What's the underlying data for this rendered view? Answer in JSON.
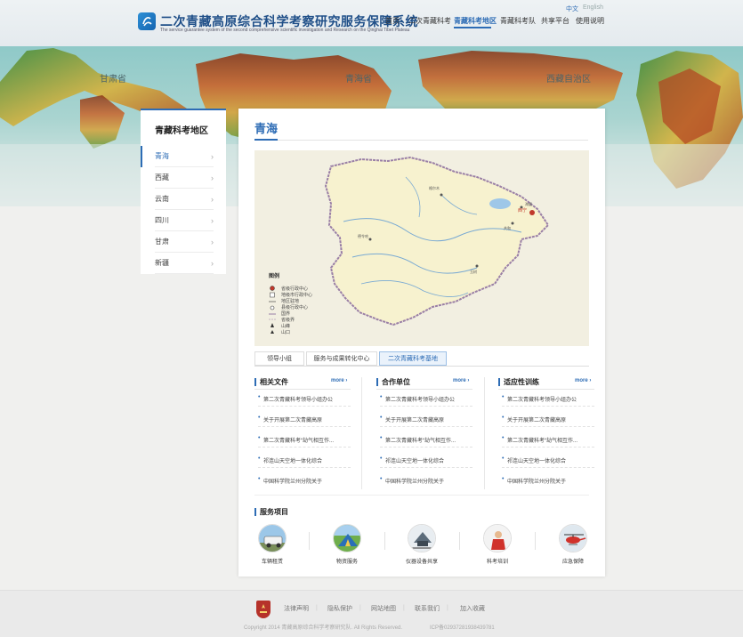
{
  "header": {
    "title": "二次青藏高原综合科学考察研究服务保障系统",
    "subtitle": "The service guarantee system of the second comprehensive scientific investigation and Research on the Qinghai Tibet Plateau",
    "lang_zh": "中文",
    "lang_en": "English",
    "nav": [
      "首页",
      "二次青藏科考",
      "青藏科考地区",
      "青藏科考队",
      "共享平台",
      "使用说明"
    ],
    "active_nav": "青藏科考地区"
  },
  "banner": {
    "labels": [
      "甘肃省",
      "青海省",
      "西藏自治区"
    ]
  },
  "sidebar": {
    "title": "青藏科考地区",
    "items": [
      "青海",
      "西藏",
      "云南",
      "四川",
      "甘肃",
      "新疆"
    ],
    "active": "青海"
  },
  "main": {
    "title": "青海",
    "map": {
      "legend_title": "图例",
      "legend_items": [
        "省级行政中心",
        "地级市行政中心",
        "地区驻地",
        "县级行政中心",
        "国界",
        "省级界",
        "山峰",
        "山口"
      ],
      "capital_label": "西宁",
      "place_labels": [
        "格尔木",
        "德令哈",
        "玉树",
        "共和",
        "海晏"
      ]
    },
    "tabs": [
      "领导小组",
      "服务与成果转化中心",
      "二次青藏科考基地"
    ],
    "active_tab": "二次青藏科考基地",
    "columns": [
      {
        "title": "相关文件",
        "more": "more",
        "items": [
          "第二次青藏科考领导小组办公",
          "关于开展第二次青藏高原",
          "第二次青藏科考“劫气相互作...",
          "祁连山天空地一体化综合",
          "中国科学院兰州分院关于"
        ]
      },
      {
        "title": "合作单位",
        "more": "more",
        "items": [
          "第二次青藏科考领导小组办公",
          "关于开展第二次青藏高原",
          "第二次青藏科考“劫气相互作...",
          "祁连山天空地一体化综合",
          "中国科学院兰州分院关于"
        ]
      },
      {
        "title": "适应性训练",
        "more": "more",
        "items": [
          "第二次青藏科考领导小组办公",
          "关于开展第二次青藏高原",
          "第二次青藏科考“劫气相互作...",
          "祁连山天空地一体化综合",
          "中国科学院兰州分院关于"
        ]
      }
    ],
    "services_title": "服务项目",
    "services": [
      "车辆租赁",
      "物资服务",
      "仪器设备共享",
      "科考培训",
      "应急保障"
    ]
  },
  "footer": {
    "links": [
      "法律声明",
      "隐私保护",
      "网站地图",
      "联系我们",
      "加入收藏"
    ],
    "copyright": "Copyright 2014 青藏高原综合科学考察研究队. All Rights Reserved.",
    "icp": "ICP备02937281938439781"
  },
  "colors": {
    "accent": "#2d6cb5",
    "footer_bg": "#eaeaea",
    "map_fill": "#f7f2cf"
  }
}
